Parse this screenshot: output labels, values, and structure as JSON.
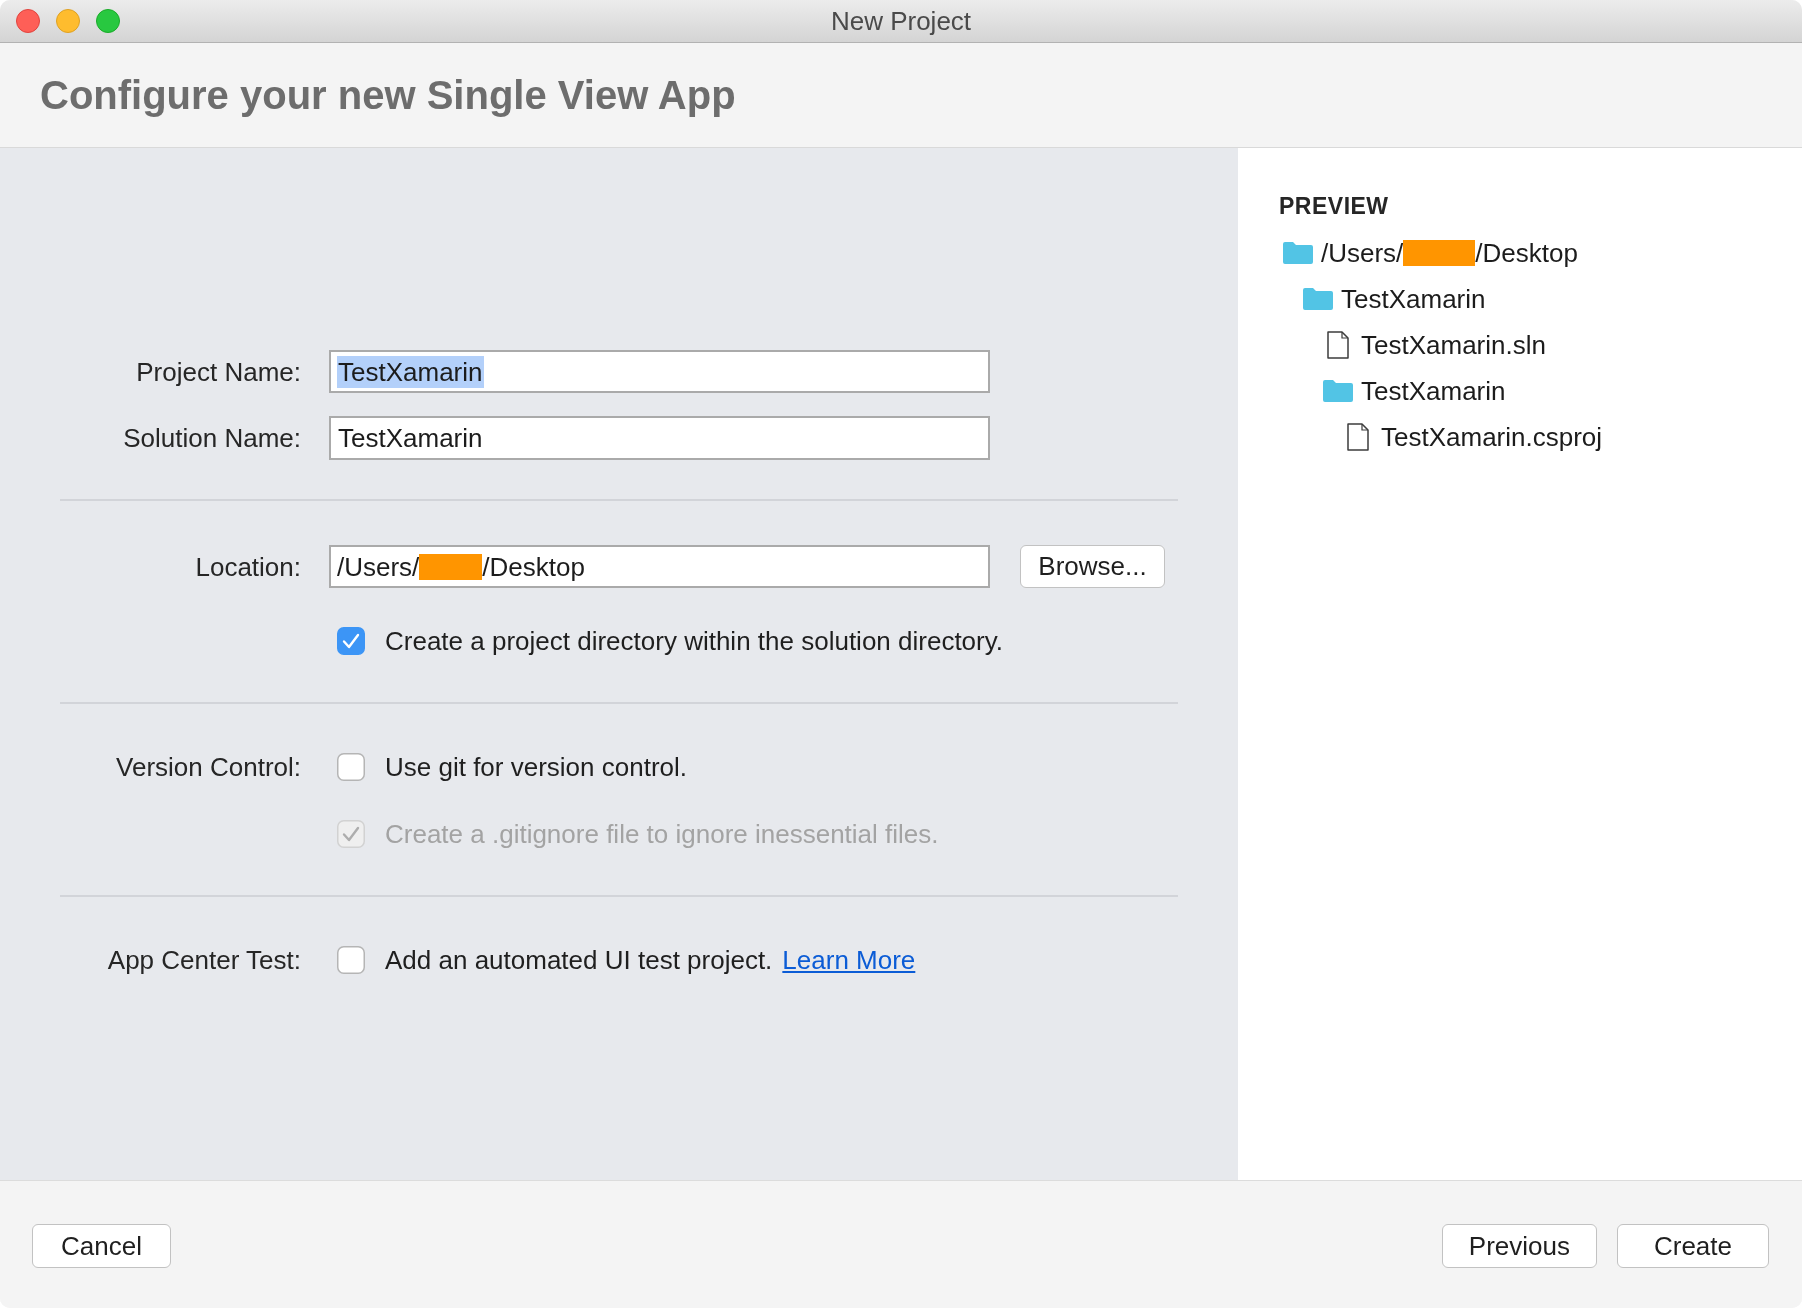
{
  "window": {
    "title": "New Project"
  },
  "header": {
    "title": "Configure your new Single View App"
  },
  "form": {
    "project_name": {
      "label": "Project Name:",
      "value": "TestXamarin",
      "text_selected": true
    },
    "solution_name": {
      "label": "Solution Name:",
      "value": "TestXamarin",
      "text_selected": false
    },
    "location": {
      "label": "Location:",
      "value_segments": [
        {
          "kind": "text",
          "text": "/Users/"
        },
        {
          "kind": "redaction"
        },
        {
          "kind": "text",
          "text": "/Desktop"
        }
      ],
      "browse_button": "Browse..."
    },
    "create_directory": {
      "label": "Create a project directory within the solution directory.",
      "checked": true,
      "disabled": false
    },
    "version_control": {
      "label": "Version Control:",
      "options": [
        {
          "label": "Use git for version control.",
          "checked": false,
          "disabled": false
        },
        {
          "label": "Create a .gitignore file to ignore inessential files.",
          "checked": true,
          "disabled": true
        }
      ]
    },
    "app_center_test": {
      "label": "App Center Test:",
      "option": {
        "label": "Add an automated UI test project.",
        "checked": false,
        "disabled": false
      },
      "link": "Learn More"
    }
  },
  "preview": {
    "title": "PREVIEW",
    "tree": [
      {
        "kind": "folder",
        "name_segments": [
          {
            "kind": "text",
            "text": "/Users/"
          },
          {
            "kind": "redaction"
          },
          {
            "kind": "text",
            "text": "/Desktop"
          }
        ],
        "children": [
          {
            "kind": "folder",
            "name": "TestXamarin",
            "children": [
              {
                "kind": "file",
                "name": "TestXamarin.sln"
              },
              {
                "kind": "folder",
                "name": "TestXamarin",
                "children": [
                  {
                    "kind": "file",
                    "name": "TestXamarin.csproj"
                  }
                ]
              }
            ]
          }
        ]
      }
    ]
  },
  "footer": {
    "left_buttons": [
      "Cancel"
    ],
    "right_buttons": [
      "Previous",
      "Create"
    ]
  }
}
